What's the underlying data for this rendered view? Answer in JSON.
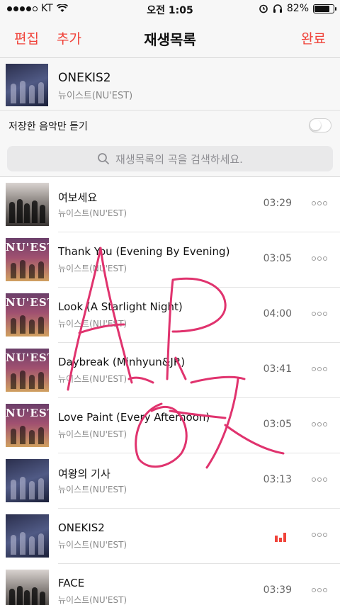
{
  "status": {
    "carrier": "KT",
    "time": "오전 1:05",
    "battery_percent": "82%",
    "battery_level": 0.82
  },
  "nav": {
    "edit_label": "편집",
    "add_label": "추가",
    "title": "재생목록",
    "done_label": "완료"
  },
  "album": {
    "title": "ONEKIS2",
    "artist": "뉴이스트(NU'EST)"
  },
  "filter": {
    "label": "저장한 음악만 듣기",
    "enabled": false
  },
  "search": {
    "placeholder": "재생목록의 곡을 검색하세요."
  },
  "songs": [
    {
      "title": "여보세요",
      "artist": "뉴이스트(NU'EST)",
      "duration": "03:29",
      "cover": "mv"
    },
    {
      "title": "Thank You (Evening By Evening)",
      "artist": "뉴이스트(NU'EST)",
      "duration": "03:05",
      "cover": "nuest"
    },
    {
      "title": "Look (A Starlight Night)",
      "artist": "뉴이스트(NU'EST)",
      "duration": "04:00",
      "cover": "nuest"
    },
    {
      "title": "Daybreak (Minhyun&JR)",
      "artist": "뉴이스트(NU'EST)",
      "duration": "03:41",
      "cover": "nuest"
    },
    {
      "title": "Love Paint (Every Afternoon)",
      "artist": "뉴이스트(NU'EST)",
      "duration": "03:05",
      "cover": "nuest"
    },
    {
      "title": "여왕의 기사",
      "artist": "뉴이스트(NU'EST)",
      "duration": "03:13",
      "cover": "dark"
    },
    {
      "title": "ONEKIS2",
      "artist": "뉴이스트(NU'EST)",
      "duration": "",
      "cover": "dark",
      "now_playing": true
    },
    {
      "title": "FACE",
      "artist": "뉴이스트(NU'EST)",
      "duration": "03:39",
      "cover": "mv"
    }
  ],
  "cover_text": {
    "nuest_logo": "NU'EST"
  },
  "colors": {
    "accent": "#f0433a",
    "scribble": "#e0336e"
  }
}
